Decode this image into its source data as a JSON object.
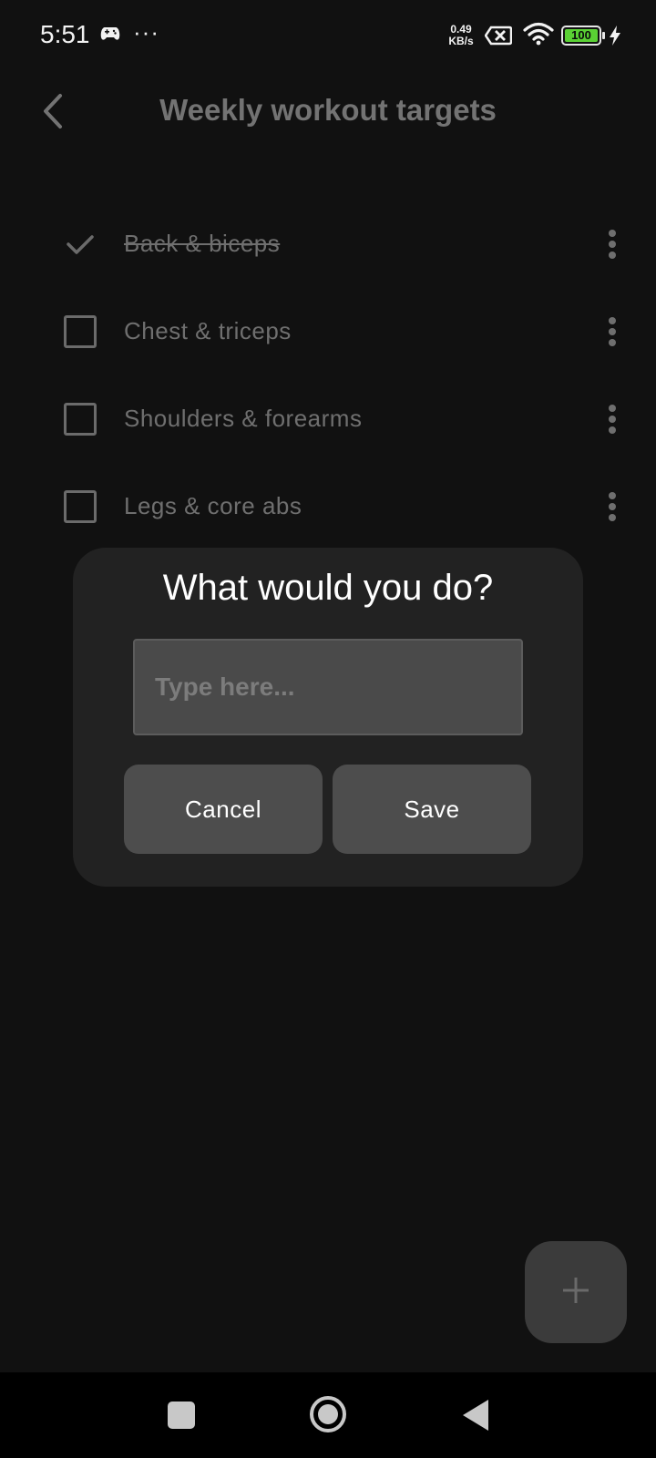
{
  "status_bar": {
    "time": "5:51",
    "overflow": "···",
    "net_speed_value": "0.49",
    "net_speed_unit": "KB/s",
    "battery_level": "100",
    "icons": [
      "gamepad-icon",
      "sim-x-icon",
      "wifi-icon",
      "battery-icon",
      "charging-icon"
    ]
  },
  "header": {
    "title": "Weekly workout targets",
    "back_icon": "chevron-left-icon"
  },
  "list": {
    "items": [
      {
        "label": "Back & biceps",
        "checked": true
      },
      {
        "label": "Chest & triceps",
        "checked": false
      },
      {
        "label": "Shoulders & forearms",
        "checked": false
      },
      {
        "label": "Legs & core abs",
        "checked": false
      }
    ]
  },
  "dialog": {
    "title": "What would you do?",
    "input_value": "",
    "input_placeholder": "Type here...",
    "cancel_label": "Cancel",
    "save_label": "Save"
  },
  "fab": {
    "icon": "plus-icon"
  },
  "nav_bar": {
    "icons": [
      "recents-square-icon",
      "home-circle-icon",
      "back-triangle-icon"
    ]
  },
  "colors": {
    "background": "#111111",
    "dialog": "#222222",
    "button": "#4d4d4d",
    "muted_text": "#6f6f6f",
    "battery_fill": "#5ad134"
  }
}
